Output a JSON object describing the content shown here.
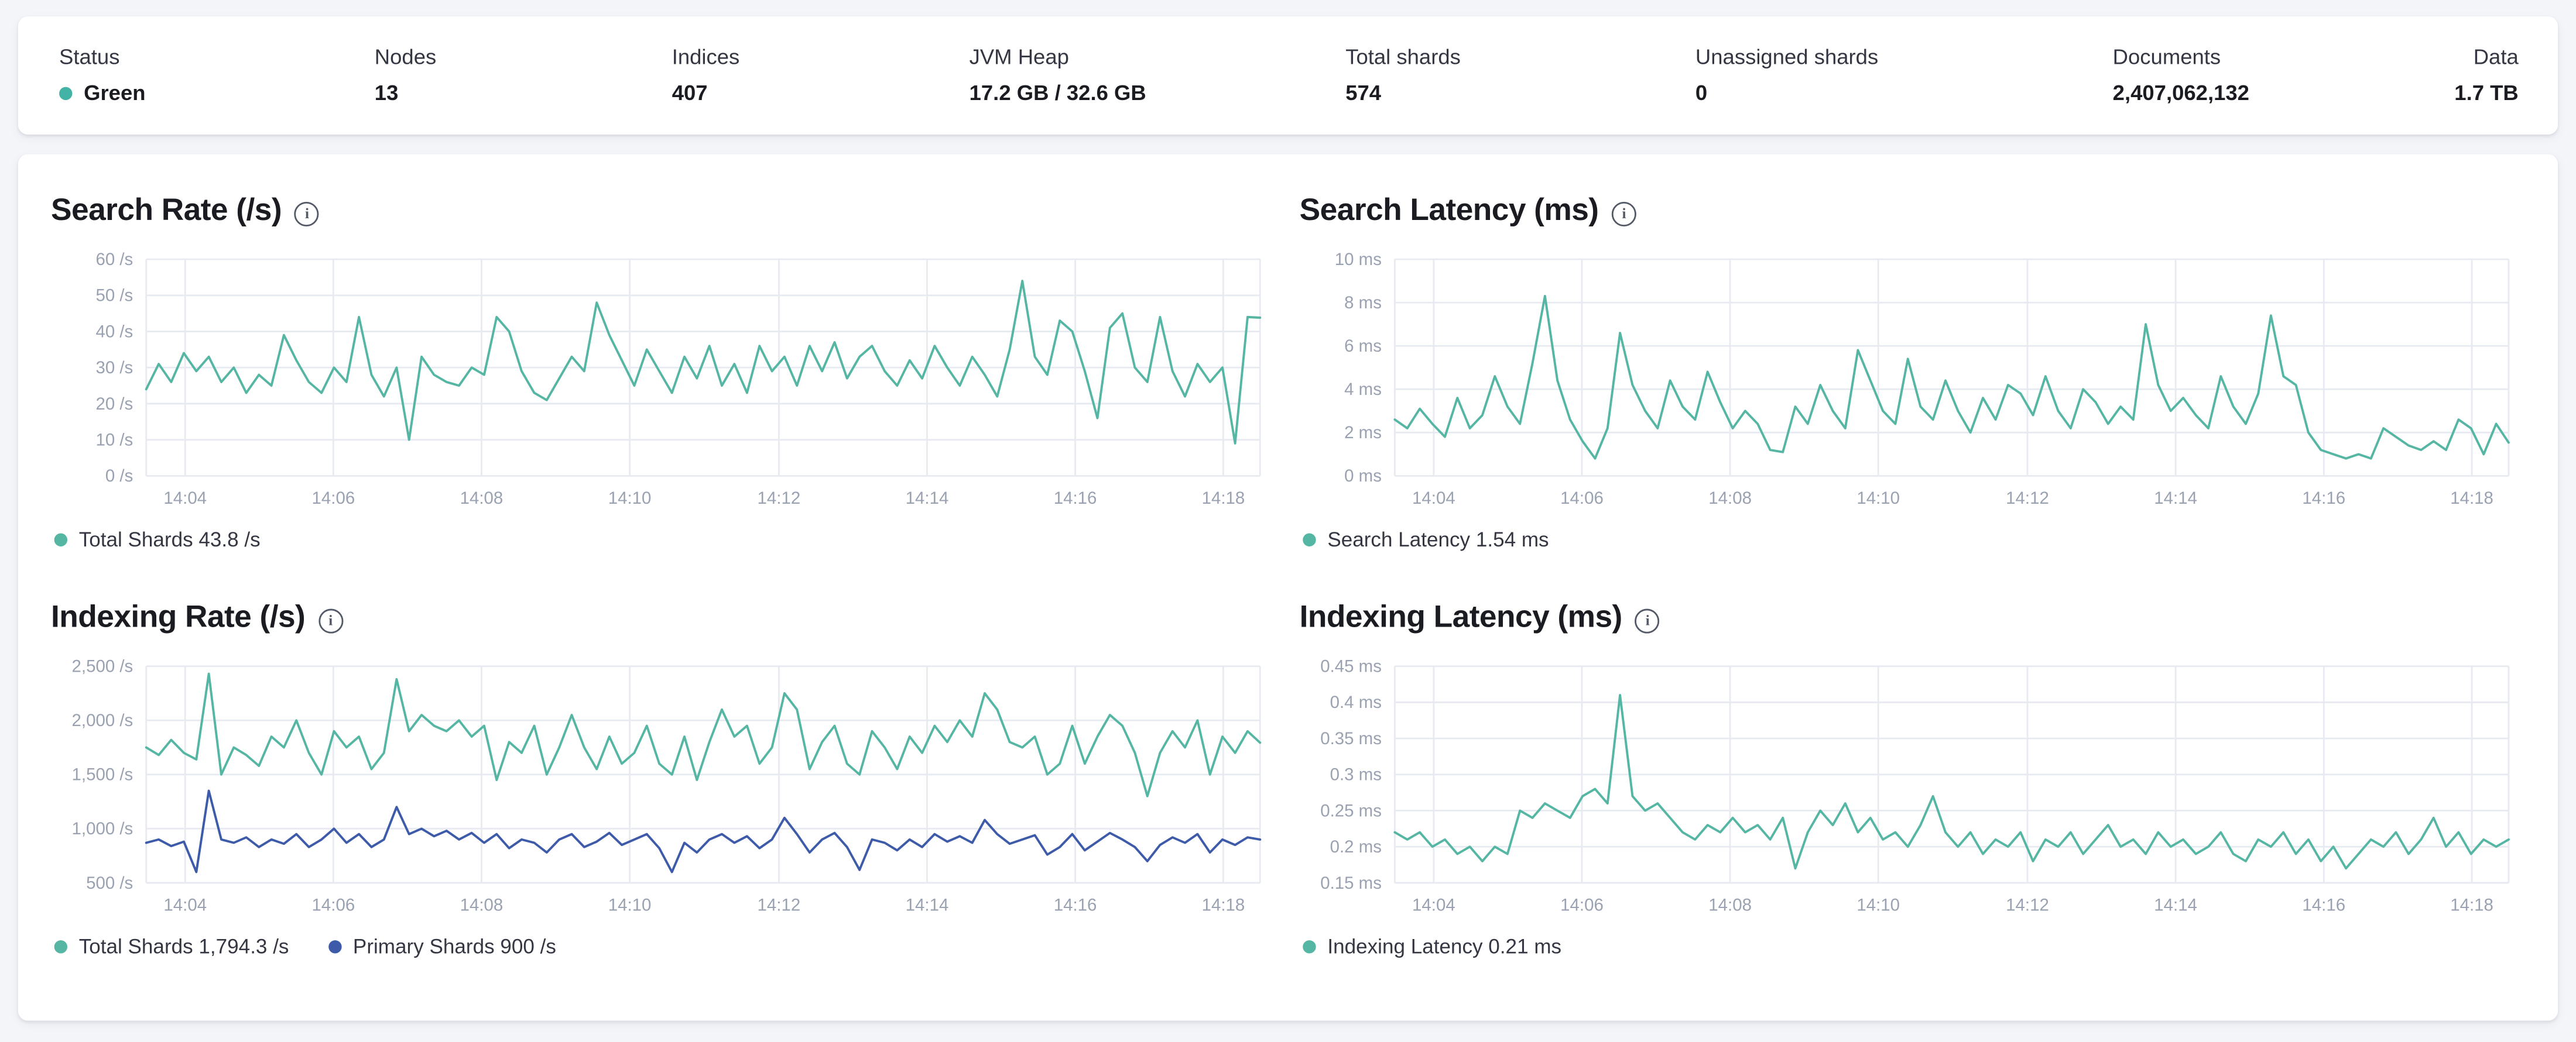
{
  "colors": {
    "teal": "#55b6a3",
    "blue": "#3d5ba9",
    "status_green": "#42b3a4",
    "grid": "#e7eaf0",
    "tick": "#9aa2b1",
    "page_background": "#f3f5f9",
    "card_background": "#ffffff"
  },
  "stats": [
    {
      "label": "Status",
      "value": "Green",
      "type": "status"
    },
    {
      "label": "Nodes",
      "value": "13"
    },
    {
      "label": "Indices",
      "value": "407"
    },
    {
      "label": "JVM Heap",
      "value": "17.2 GB / 32.6 GB"
    },
    {
      "label": "Total shards",
      "value": "574"
    },
    {
      "label": "Unassigned shards",
      "value": "0"
    },
    {
      "label": "Documents",
      "value": "2,407,062,132"
    },
    {
      "label": "Data",
      "value": "1.7 TB"
    }
  ],
  "chart_data": [
    {
      "type": "line",
      "title": "Search Rate (/s)",
      "ylabel": "",
      "ylim": [
        0,
        60
      ],
      "grid": true,
      "legend_position": "bottom",
      "y_ticks": [
        {
          "value": 0,
          "label": "0 /s"
        },
        {
          "value": 10,
          "label": "10 /s"
        },
        {
          "value": 20,
          "label": "20 /s"
        },
        {
          "value": 30,
          "label": "30 /s"
        },
        {
          "value": 40,
          "label": "40 /s"
        },
        {
          "value": 50,
          "label": "50 /s"
        },
        {
          "value": 60,
          "label": "60 /s"
        }
      ],
      "x_ticks": [
        {
          "frac": 0.035,
          "label": "14:04"
        },
        {
          "frac": 0.168,
          "label": "14:06"
        },
        {
          "frac": 0.301,
          "label": "14:08"
        },
        {
          "frac": 0.434,
          "label": "14:10"
        },
        {
          "frac": 0.568,
          "label": "14:12"
        },
        {
          "frac": 0.701,
          "label": "14:14"
        },
        {
          "frac": 0.834,
          "label": "14:16"
        },
        {
          "frac": 0.967,
          "label": "14:18"
        }
      ],
      "series": [
        {
          "name": "Total Shards",
          "legend": "Total Shards 43.8 /s",
          "color": "#55b6a3",
          "values": [
            24,
            31,
            26,
            34,
            29,
            33,
            26,
            30,
            23,
            28,
            25,
            39,
            32,
            26,
            23,
            30,
            26,
            44,
            28,
            22,
            30,
            10,
            33,
            28,
            26,
            25,
            30,
            28,
            44,
            40,
            29,
            23,
            21,
            27,
            33,
            29,
            48,
            39,
            32,
            25,
            35,
            29,
            23,
            33,
            27,
            36,
            25,
            31,
            23,
            36,
            29,
            33,
            25,
            36,
            29,
            37,
            27,
            33,
            36,
            29,
            25,
            32,
            27,
            36,
            30,
            25,
            33,
            28,
            22,
            35,
            54,
            33,
            28,
            43,
            40,
            29,
            16,
            41,
            45,
            30,
            26,
            44,
            29,
            22,
            31,
            26,
            30,
            9,
            44,
            43.8
          ]
        }
      ]
    },
    {
      "type": "line",
      "title": "Search Latency (ms)",
      "ylabel": "",
      "ylim": [
        0,
        10
      ],
      "grid": true,
      "legend_position": "bottom",
      "y_ticks": [
        {
          "value": 0,
          "label": "0 ms"
        },
        {
          "value": 2,
          "label": "2 ms"
        },
        {
          "value": 4,
          "label": "4 ms"
        },
        {
          "value": 6,
          "label": "6 ms"
        },
        {
          "value": 8,
          "label": "8 ms"
        },
        {
          "value": 10,
          "label": "10 ms"
        }
      ],
      "x_ticks": [
        {
          "frac": 0.035,
          "label": "14:04"
        },
        {
          "frac": 0.168,
          "label": "14:06"
        },
        {
          "frac": 0.301,
          "label": "14:08"
        },
        {
          "frac": 0.434,
          "label": "14:10"
        },
        {
          "frac": 0.568,
          "label": "14:12"
        },
        {
          "frac": 0.701,
          "label": "14:14"
        },
        {
          "frac": 0.834,
          "label": "14:16"
        },
        {
          "frac": 0.967,
          "label": "14:18"
        }
      ],
      "series": [
        {
          "name": "Search Latency",
          "legend": "Search Latency 1.54 ms",
          "color": "#55b6a3",
          "values": [
            2.6,
            2.2,
            3.1,
            2.4,
            1.8,
            3.6,
            2.2,
            2.8,
            4.6,
            3.2,
            2.4,
            5.2,
            8.3,
            4.4,
            2.6,
            1.6,
            0.8,
            2.2,
            6.6,
            4.2,
            3.0,
            2.2,
            4.4,
            3.2,
            2.6,
            4.8,
            3.4,
            2.2,
            3.0,
            2.4,
            1.2,
            1.1,
            3.2,
            2.4,
            4.2,
            3.0,
            2.2,
            5.8,
            4.4,
            3.0,
            2.4,
            5.4,
            3.2,
            2.6,
            4.4,
            3.0,
            2.0,
            3.6,
            2.6,
            4.2,
            3.8,
            2.8,
            4.6,
            3.0,
            2.2,
            4.0,
            3.4,
            2.4,
            3.2,
            2.6,
            7.0,
            4.2,
            3.0,
            3.6,
            2.8,
            2.2,
            4.6,
            3.2,
            2.4,
            3.8,
            7.4,
            4.6,
            4.2,
            2.0,
            1.2,
            1.0,
            0.8,
            1.0,
            0.8,
            2.2,
            1.8,
            1.4,
            1.2,
            1.6,
            1.2,
            2.6,
            2.2,
            1.0,
            2.4,
            1.54
          ]
        }
      ]
    },
    {
      "type": "line",
      "title": "Indexing Rate (/s)",
      "ylabel": "",
      "ylim": [
        500,
        2500
      ],
      "grid": true,
      "legend_position": "bottom",
      "y_ticks": [
        {
          "value": 500,
          "label": "500 /s"
        },
        {
          "value": 1000,
          "label": "1,000 /s"
        },
        {
          "value": 1500,
          "label": "1,500 /s"
        },
        {
          "value": 2000,
          "label": "2,000 /s"
        },
        {
          "value": 2500,
          "label": "2,500 /s"
        }
      ],
      "x_ticks": [
        {
          "frac": 0.035,
          "label": "14:04"
        },
        {
          "frac": 0.168,
          "label": "14:06"
        },
        {
          "frac": 0.301,
          "label": "14:08"
        },
        {
          "frac": 0.434,
          "label": "14:10"
        },
        {
          "frac": 0.568,
          "label": "14:12"
        },
        {
          "frac": 0.701,
          "label": "14:14"
        },
        {
          "frac": 0.834,
          "label": "14:16"
        },
        {
          "frac": 0.967,
          "label": "14:18"
        }
      ],
      "series": [
        {
          "name": "Total Shards",
          "legend": "Total Shards 1,794.3 /s",
          "color": "#55b6a3",
          "values": [
            1750,
            1680,
            1820,
            1700,
            1640,
            2430,
            1500,
            1750,
            1680,
            1580,
            1850,
            1750,
            2000,
            1700,
            1500,
            1900,
            1750,
            1850,
            1550,
            1700,
            2380,
            1900,
            2050,
            1950,
            1900,
            2000,
            1850,
            1950,
            1450,
            1800,
            1700,
            1950,
            1500,
            1750,
            2050,
            1750,
            1550,
            1850,
            1600,
            1700,
            1950,
            1600,
            1500,
            1850,
            1450,
            1800,
            2100,
            1850,
            1950,
            1600,
            1750,
            2250,
            2100,
            1550,
            1800,
            1950,
            1600,
            1500,
            1900,
            1750,
            1550,
            1850,
            1700,
            1950,
            1800,
            2000,
            1850,
            2250,
            2100,
            1800,
            1750,
            1850,
            1500,
            1600,
            1950,
            1600,
            1850,
            2050,
            1950,
            1700,
            1300,
            1700,
            1900,
            1750,
            2000,
            1500,
            1850,
            1700,
            1900,
            1794.3
          ]
        },
        {
          "name": "Primary Shards",
          "legend": "Primary Shards 900 /s",
          "color": "#3d5ba9",
          "values": [
            870,
            900,
            840,
            880,
            600,
            1350,
            900,
            870,
            920,
            830,
            900,
            860,
            950,
            830,
            900,
            1000,
            870,
            950,
            830,
            900,
            1200,
            950,
            1000,
            930,
            980,
            900,
            960,
            870,
            950,
            820,
            900,
            870,
            780,
            900,
            950,
            830,
            880,
            960,
            850,
            900,
            950,
            820,
            600,
            870,
            780,
            900,
            950,
            870,
            930,
            820,
            900,
            1100,
            950,
            780,
            900,
            960,
            830,
            620,
            900,
            870,
            800,
            900,
            830,
            950,
            880,
            930,
            870,
            1080,
            950,
            860,
            900,
            940,
            760,
            830,
            950,
            800,
            880,
            960,
            900,
            830,
            700,
            850,
            920,
            870,
            950,
            780,
            900,
            850,
            920,
            900
          ]
        }
      ]
    },
    {
      "type": "line",
      "title": "Indexing Latency (ms)",
      "ylabel": "",
      "ylim": [
        0.15,
        0.45
      ],
      "grid": true,
      "legend_position": "bottom",
      "y_ticks": [
        {
          "value": 0.15,
          "label": "0.15 ms"
        },
        {
          "value": 0.2,
          "label": "0.2 ms"
        },
        {
          "value": 0.25,
          "label": "0.25 ms"
        },
        {
          "value": 0.3,
          "label": "0.3 ms"
        },
        {
          "value": 0.35,
          "label": "0.35 ms"
        },
        {
          "value": 0.4,
          "label": "0.4 ms"
        },
        {
          "value": 0.45,
          "label": "0.45 ms"
        }
      ],
      "x_ticks": [
        {
          "frac": 0.035,
          "label": "14:04"
        },
        {
          "frac": 0.168,
          "label": "14:06"
        },
        {
          "frac": 0.301,
          "label": "14:08"
        },
        {
          "frac": 0.434,
          "label": "14:10"
        },
        {
          "frac": 0.568,
          "label": "14:12"
        },
        {
          "frac": 0.701,
          "label": "14:14"
        },
        {
          "frac": 0.834,
          "label": "14:16"
        },
        {
          "frac": 0.967,
          "label": "14:18"
        }
      ],
      "series": [
        {
          "name": "Indexing Latency",
          "legend": "Indexing Latency 0.21 ms",
          "color": "#55b6a3",
          "values": [
            0.22,
            0.21,
            0.22,
            0.2,
            0.21,
            0.19,
            0.2,
            0.18,
            0.2,
            0.19,
            0.25,
            0.24,
            0.26,
            0.25,
            0.24,
            0.27,
            0.28,
            0.26,
            0.41,
            0.27,
            0.25,
            0.26,
            0.24,
            0.22,
            0.21,
            0.23,
            0.22,
            0.24,
            0.22,
            0.23,
            0.21,
            0.24,
            0.17,
            0.22,
            0.25,
            0.23,
            0.26,
            0.22,
            0.24,
            0.21,
            0.22,
            0.2,
            0.23,
            0.27,
            0.22,
            0.2,
            0.22,
            0.19,
            0.21,
            0.2,
            0.22,
            0.18,
            0.21,
            0.2,
            0.22,
            0.19,
            0.21,
            0.23,
            0.2,
            0.21,
            0.19,
            0.22,
            0.2,
            0.21,
            0.19,
            0.2,
            0.22,
            0.19,
            0.18,
            0.21,
            0.2,
            0.22,
            0.19,
            0.21,
            0.18,
            0.2,
            0.17,
            0.19,
            0.21,
            0.2,
            0.22,
            0.19,
            0.21,
            0.24,
            0.2,
            0.22,
            0.19,
            0.21,
            0.2,
            0.21
          ]
        }
      ]
    }
  ]
}
